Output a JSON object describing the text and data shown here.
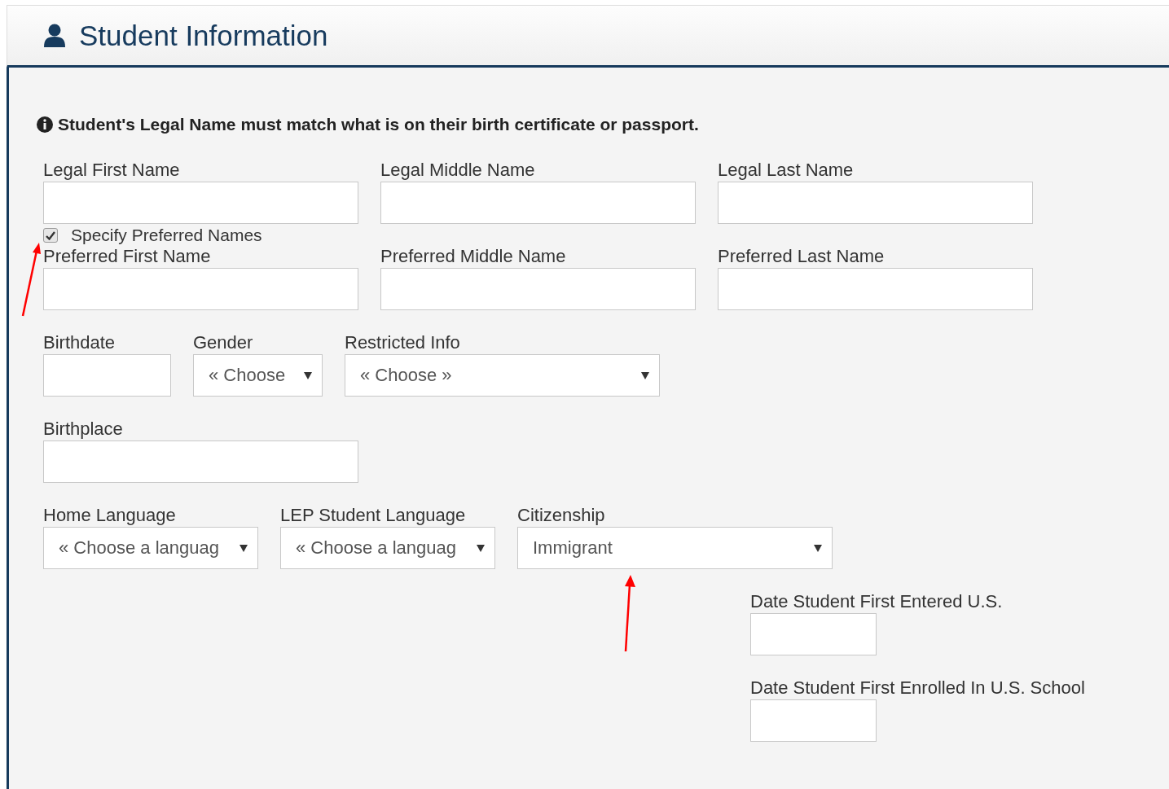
{
  "header": {
    "title": "Student Information"
  },
  "notice": "Student's Legal Name must match what is on their birth certificate or passport.",
  "legal_names": [
    {
      "label": "Legal First Name",
      "kind": "text"
    },
    {
      "label": "Legal Middle Name",
      "kind": "text"
    },
    {
      "label": "Legal Last Name",
      "kind": "text"
    }
  ],
  "preferred_toggle": {
    "label": "Specify Preferred Names",
    "checked": true
  },
  "preferred_names": [
    {
      "label": "Preferred First Name",
      "kind": "text"
    },
    {
      "label": "Preferred Middle Name",
      "kind": "text"
    },
    {
      "label": "Preferred Last Name",
      "kind": "text"
    }
  ],
  "birth_row": [
    {
      "label": "Birthdate",
      "kind": "text"
    },
    {
      "label": "Gender",
      "kind": "select",
      "value": "« Choose"
    },
    {
      "label": "Restricted Info",
      "kind": "select",
      "value": "« Choose »"
    }
  ],
  "birthplace_row": [
    {
      "label": "Birthplace",
      "kind": "text"
    }
  ],
  "language_row": [
    {
      "label": "Home Language",
      "kind": "select",
      "value": "« Choose a languag"
    },
    {
      "label": "LEP Student Language",
      "kind": "select",
      "value": "« Choose a languag"
    },
    {
      "label": "Citizenship",
      "kind": "select",
      "value": "Immigrant"
    }
  ],
  "us_dates": [
    {
      "label": "Date Student First Entered U.S.",
      "kind": "text"
    },
    {
      "label": "Date Student First Enrolled In U.S. School",
      "kind": "text"
    }
  ]
}
